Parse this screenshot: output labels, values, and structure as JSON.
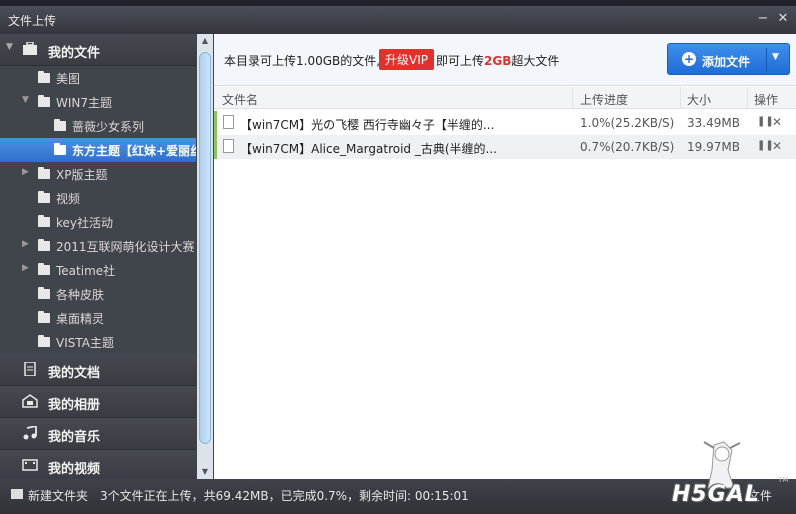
{
  "window": {
    "title": "文件上传"
  },
  "sidebar": {
    "header": "我的文件",
    "tree": [
      {
        "label": "美图",
        "level": 1,
        "arrow": ""
      },
      {
        "label": "WIN7主题",
        "level": 1,
        "arrow": "▼"
      },
      {
        "label": "蔷薇少女系列",
        "level": 2,
        "arrow": ""
      },
      {
        "label": "东方主题【红妹+爱丽丝",
        "level": 2,
        "arrow": "",
        "selected": true
      },
      {
        "label": "XP版主题",
        "level": 1,
        "arrow": "▶"
      },
      {
        "label": "视频",
        "level": 1,
        "arrow": ""
      },
      {
        "label": "key社活动",
        "level": 1,
        "arrow": ""
      },
      {
        "label": "2011互联网萌化设计大赛",
        "level": 1,
        "arrow": "▶"
      },
      {
        "label": "Teatime社",
        "level": 1,
        "arrow": "▶"
      },
      {
        "label": "各种皮肤",
        "level": 1,
        "arrow": ""
      },
      {
        "label": "桌面精灵",
        "level": 1,
        "arrow": ""
      },
      {
        "label": "VISTA主题",
        "level": 1,
        "arrow": ""
      }
    ],
    "sections": [
      "我的文档",
      "我的相册",
      "我的音乐",
      "我的视频"
    ]
  },
  "info": {
    "text_before": "本目录可上传1.00GB的文件,",
    "vip_button": "升级VIP",
    "text_after_a": "即可上传",
    "text_after_red": "2GB",
    "text_after_b": "超大文件",
    "add_button": "添加文件"
  },
  "table": {
    "headers": [
      "文件名",
      "上传进度",
      "大小",
      "操作"
    ],
    "rows": [
      {
        "name": "【win7CM】光の飞樱 西行寺幽々子【半缠的...",
        "progress": "1.0%(25.2KB/S)",
        "size": "33.49MB"
      },
      {
        "name": "【win7CM】Alice_Margatroid _古典(半缠的...",
        "progress": "0.7%(20.7KB/S)",
        "size": "19.97MB"
      }
    ]
  },
  "status": {
    "new_folder": "新建文件夹",
    "summary": "3个文件正在上传，共69.42MB，已完成0.7%，剩余时间: 00:15:01",
    "right_text": "文件"
  },
  "watermark": {
    "text": "H5GAL",
    "tm": "TM"
  },
  "colors": {
    "accent": "#2f6fcd",
    "vip": "#e2312a",
    "progress_bar": "#8fc45a"
  }
}
